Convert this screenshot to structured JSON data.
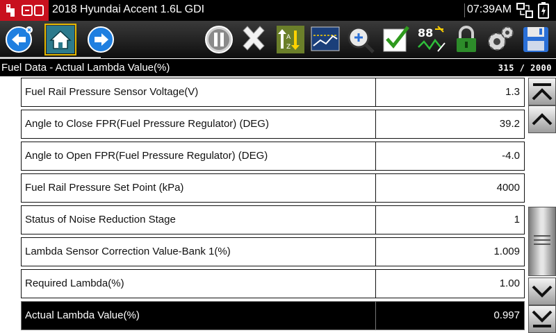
{
  "titlebar": {
    "title": "2018 Hyundai Accent 1.6L GDI",
    "time": "07:39AM",
    "logo_icon": "snap-on-logo",
    "vci_icon": "vci-connection-icon",
    "battery_icon": "battery-icon",
    "brand_color": "#c8101e"
  },
  "toolbar": {
    "buttons": [
      {
        "id": "back",
        "icon": "back-arrow-icon"
      },
      {
        "id": "home",
        "icon": "home-icon",
        "active": true
      },
      {
        "id": "forward",
        "icon": "forward-arrow-icon"
      },
      {
        "id": "pause",
        "icon": "pause-icon"
      },
      {
        "id": "clear",
        "icon": "x-icon"
      },
      {
        "id": "sort",
        "icon": "sort-icon"
      },
      {
        "id": "graph",
        "icon": "graph-icon"
      },
      {
        "id": "zoom",
        "icon": "zoom-icon"
      },
      {
        "id": "custom-list",
        "icon": "checkmark-icon"
      },
      {
        "id": "units",
        "icon": "units-icon",
        "text": "88"
      },
      {
        "id": "lock",
        "icon": "lock-icon"
      },
      {
        "id": "settings",
        "icon": "gear-icon"
      },
      {
        "id": "save",
        "icon": "save-icon"
      }
    ],
    "accent_color": "#e4b800"
  },
  "subheader": {
    "label": "Fuel Data - Actual Lambda Value(%)",
    "count": "315 / 2000"
  },
  "data_list": [
    {
      "name": "Fuel Rail Pressure Sensor Voltage(V)",
      "value": "1.3"
    },
    {
      "name": "Angle to Close FPR(Fuel Pressure Regulator) (DEG)",
      "value": "39.2"
    },
    {
      "name": "Angle to Open FPR(Fuel Pressure Regulator) (DEG)",
      "value": "-4.0"
    },
    {
      "name": "Fuel Rail Pressure Set Point (kPa)",
      "value": "4000"
    },
    {
      "name": "Status of Noise Reduction Stage",
      "value": "1"
    },
    {
      "name": "Lambda Sensor Correction Value-Bank 1(%)",
      "value": "1.009"
    },
    {
      "name": "Required Lambda(%)",
      "value": "1.00"
    },
    {
      "name": "Actual Lambda Value(%)",
      "value": "0.997",
      "selected": true
    }
  ],
  "scrollbar": {
    "buttons": [
      "scroll-top-icon",
      "scroll-up-icon",
      "scroll-down-icon",
      "scroll-bottom-icon"
    ]
  }
}
